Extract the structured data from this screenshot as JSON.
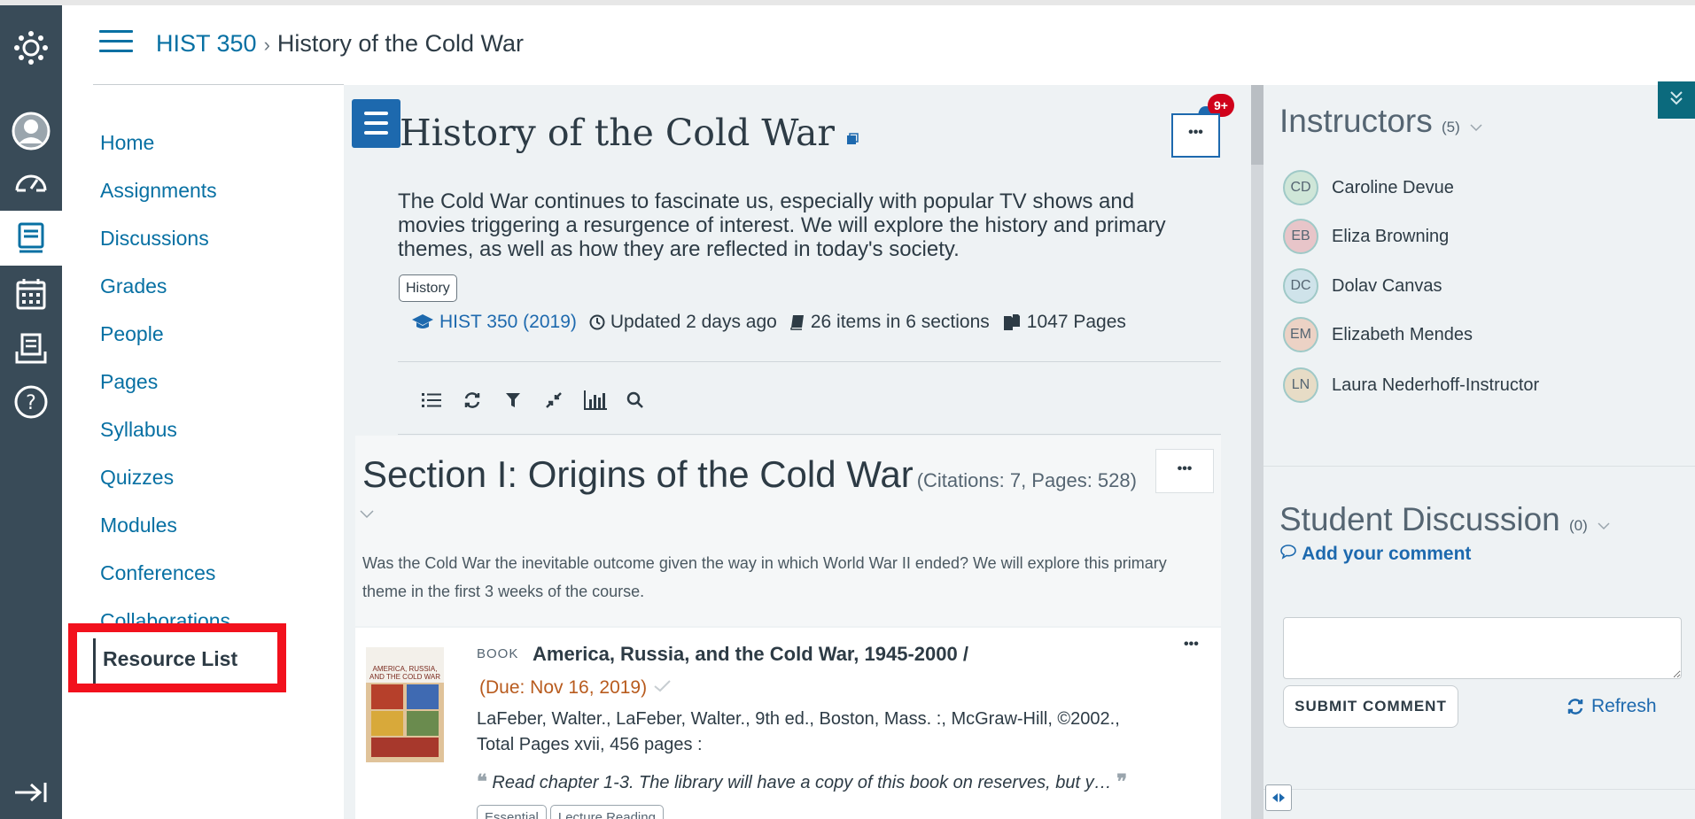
{
  "breadcrumb": {
    "course": "HIST 350",
    "separator": "›",
    "current": "History of the Cold War"
  },
  "global_nav": [
    "logo-icon",
    "account-icon",
    "dashboard-icon",
    "courses-icon",
    "calendar-icon",
    "inbox-icon",
    "help-icon",
    "collapse-icon"
  ],
  "course_nav": {
    "items": [
      "Home",
      "Assignments",
      "Discussions",
      "Grades",
      "People",
      "Pages",
      "Syllabus",
      "Quizzes",
      "Modules",
      "Conferences",
      "Collaborations"
    ],
    "active": "Resource List"
  },
  "list": {
    "title": "History of the Cold War",
    "notification_badge": "9+",
    "more_label": "•••",
    "description": "The Cold War continues to fascinate us, especially with popular TV shows and movies triggering a resurgence of interest. We will explore the history and primary themes, as well as how they are reflected in today's society.",
    "tag": "History",
    "course_link": "HIST 350 (2019)",
    "updated": "Updated 2 days ago",
    "items_count": "26 items in 6 sections",
    "pages": "1047 Pages"
  },
  "toolbar": [
    "list-icon",
    "sync-icon",
    "filter-icon",
    "collapse-all-icon",
    "chart-icon",
    "search-icon"
  ],
  "section": {
    "title": "Section I: Origins of the Cold War",
    "meta": "(Citations: 7, Pages: 528)",
    "more_label": "•••",
    "description": "Was the Cold War the inevitable outcome given the way in which World War II ended? We will explore this primary theme in the first 3 weeks of the course."
  },
  "item": {
    "type": "BOOK",
    "title": "America, Russia, and the Cold War, 1945-2000 /",
    "due": "(Due:  Nov 16, 2019)",
    "authors": "LaFeber, Walter.,  LaFeber, Walter.,  9th ed.,  Boston, Mass. :,  McGraw-Hill, ©2002.,",
    "pages": "Total Pages xvii, 456 pages :",
    "note": "Read chapter 1-3. The library will have a copy of this book on reserves, but y…",
    "more_label": "•••",
    "cover_text": "AMERICA, RUSSIA, AND THE COLD WAR",
    "tags": [
      "Essential",
      "Lecture Reading"
    ]
  },
  "sidebar": {
    "instructors_title": "Instructors",
    "instructors_count": "(5)",
    "instructors": [
      {
        "initials": "CD",
        "name": "Caroline Devue",
        "color": "#cfe6d8"
      },
      {
        "initials": "EB",
        "name": "Eliza Browning",
        "color": "#e8c5c9"
      },
      {
        "initials": "DC",
        "name": "Dolav Canvas",
        "color": "#cfe3ea"
      },
      {
        "initials": "EM",
        "name": "Elizabeth Mendes",
        "color": "#ecd2c5"
      },
      {
        "initials": "LN",
        "name": "Laura Nederhoff-Instructor",
        "color": "#e7dcc6"
      }
    ],
    "discussion_title": "Student Discussion",
    "discussion_count": "(0)",
    "add_comment": "Add your comment",
    "submit_label": "SUBMIT COMMENT",
    "refresh_label": "Refresh"
  },
  "colors": {
    "accent": "#0770a3",
    "nav_bg": "#394b58",
    "highlight": "#f2111d",
    "badge": "#d0021b"
  }
}
